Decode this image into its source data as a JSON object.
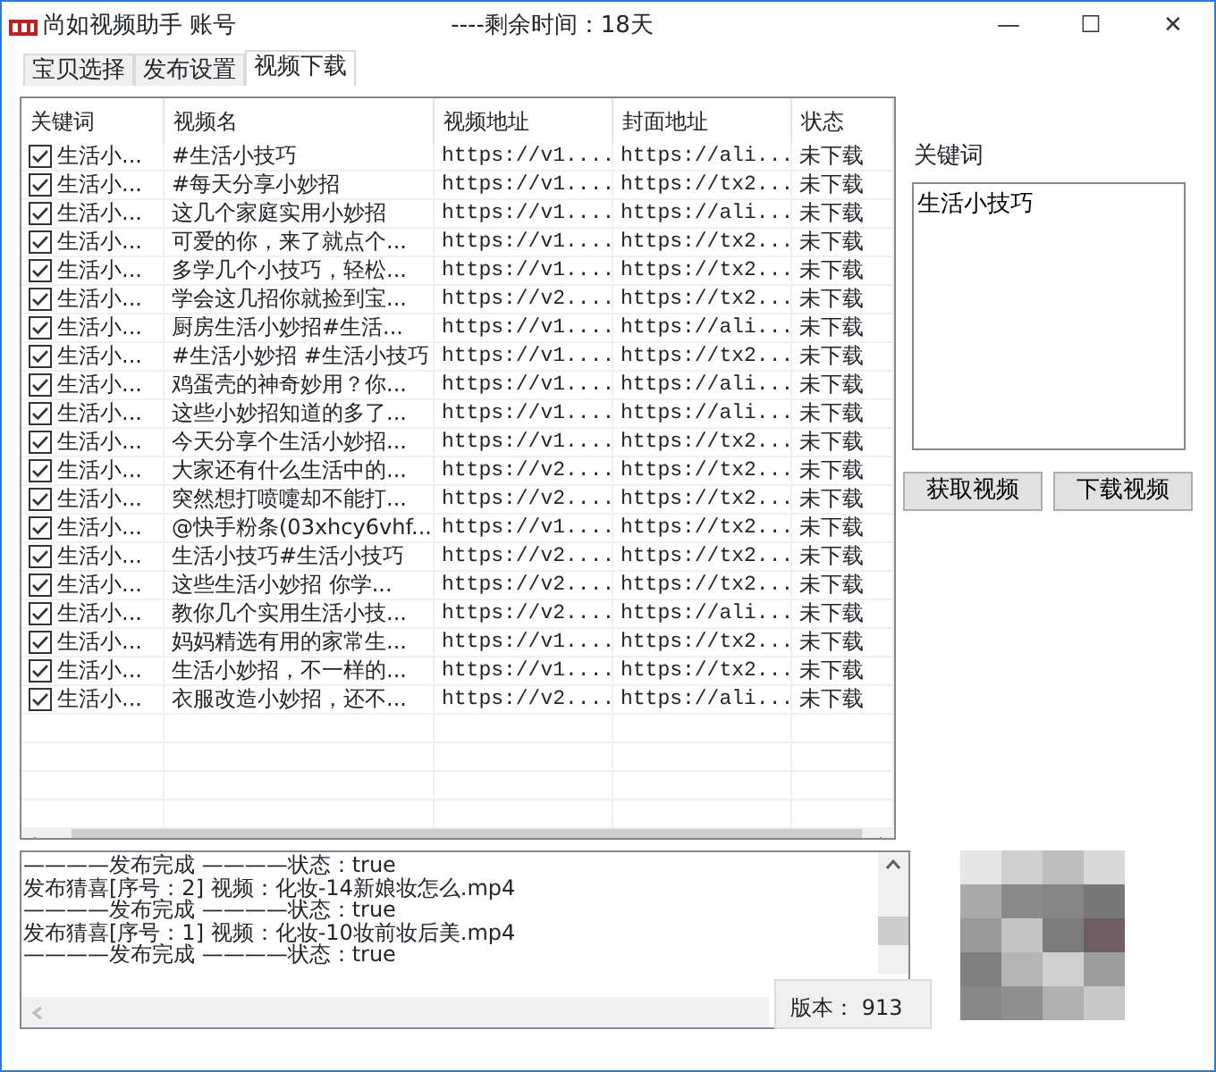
{
  "window": {
    "app_title": "尚如视频助手 账号",
    "remaining": "----剩余时间：18天",
    "controls": [
      "—",
      "☐",
      "✕"
    ]
  },
  "tabs": [
    {
      "label": "宝贝选择",
      "selected": false
    },
    {
      "label": "发布设置",
      "selected": false
    },
    {
      "label": "视频下载",
      "selected": true
    }
  ],
  "table": {
    "columns": [
      "关键词",
      "视频名",
      "视频地址",
      "封面地址",
      "状态"
    ],
    "rows": [
      {
        "checked": true,
        "keyword": "生活小...",
        "name": "#生活小技巧",
        "video_url": "https://v1....",
        "cover_url": "https://ali...",
        "status": "未下载"
      },
      {
        "checked": true,
        "keyword": "生活小...",
        "name": "#每天分享小妙招",
        "video_url": "https://v1....",
        "cover_url": "https://tx2...",
        "status": "未下载"
      },
      {
        "checked": true,
        "keyword": "生活小...",
        "name": "这几个家庭实用小妙招",
        "video_url": "https://v1....",
        "cover_url": "https://ali...",
        "status": "未下载"
      },
      {
        "checked": true,
        "keyword": "生活小...",
        "name": "可爱的你，来了就点个...",
        "video_url": "https://v1....",
        "cover_url": "https://tx2...",
        "status": "未下载"
      },
      {
        "checked": true,
        "keyword": "生活小...",
        "name": "多学几个小技巧，轻松...",
        "video_url": "https://v1....",
        "cover_url": "https://tx2...",
        "status": "未下载"
      },
      {
        "checked": true,
        "keyword": "生活小...",
        "name": "学会这几招你就捡到宝...",
        "video_url": "https://v2....",
        "cover_url": "https://tx2...",
        "status": "未下载"
      },
      {
        "checked": true,
        "keyword": "生活小...",
        "name": "厨房生活小妙招#生活...",
        "video_url": "https://v1....",
        "cover_url": "https://ali...",
        "status": "未下载"
      },
      {
        "checked": true,
        "keyword": "生活小...",
        "name": "#生活小妙招 #生活小技巧",
        "video_url": "https://v1....",
        "cover_url": "https://tx2...",
        "status": "未下载"
      },
      {
        "checked": true,
        "keyword": "生活小...",
        "name": "鸡蛋壳的神奇妙用？你...",
        "video_url": "https://v1....",
        "cover_url": "https://ali...",
        "status": "未下载"
      },
      {
        "checked": true,
        "keyword": "生活小...",
        "name": "这些小妙招知道的多了...",
        "video_url": "https://v1....",
        "cover_url": "https://ali...",
        "status": "未下载"
      },
      {
        "checked": true,
        "keyword": "生活小...",
        "name": "今天分享个生活小妙招...",
        "video_url": "https://v1....",
        "cover_url": "https://tx2...",
        "status": "未下载"
      },
      {
        "checked": true,
        "keyword": "生活小...",
        "name": "大家还有什么生活中的...",
        "video_url": "https://v2....",
        "cover_url": "https://tx2...",
        "status": "未下载"
      },
      {
        "checked": true,
        "keyword": "生活小...",
        "name": "突然想打喷嚏却不能打...",
        "video_url": "https://v2....",
        "cover_url": "https://tx2...",
        "status": "未下载"
      },
      {
        "checked": true,
        "keyword": "生活小...",
        "name": "@快手粉条(03xhcy6vhf...",
        "video_url": "https://v1....",
        "cover_url": "https://tx2...",
        "status": "未下载"
      },
      {
        "checked": true,
        "keyword": "生活小...",
        "name": "生活小技巧#生活小技巧",
        "video_url": "https://v2....",
        "cover_url": "https://tx2...",
        "status": "未下载"
      },
      {
        "checked": true,
        "keyword": "生活小...",
        "name": "这些生活小妙招 你学...",
        "video_url": "https://v2....",
        "cover_url": "https://tx2...",
        "status": "未下载"
      },
      {
        "checked": true,
        "keyword": "生活小...",
        "name": "教你几个实用生活小技...",
        "video_url": "https://v2....",
        "cover_url": "https://ali...",
        "status": "未下载"
      },
      {
        "checked": true,
        "keyword": "生活小...",
        "name": "妈妈精选有用的家常生...",
        "video_url": "https://v1....",
        "cover_url": "https://tx2...",
        "status": "未下载"
      },
      {
        "checked": true,
        "keyword": "生活小...",
        "name": "生活小妙招，不一样的...",
        "video_url": "https://v1....",
        "cover_url": "https://tx2...",
        "status": "未下载"
      },
      {
        "checked": true,
        "keyword": "生活小...",
        "name": "衣服改造小妙招，还不...",
        "video_url": "https://v2....",
        "cover_url": "https://ali...",
        "status": "未下载"
      }
    ]
  },
  "keyword_panel": {
    "label": "关键词",
    "value": "生活小技巧",
    "buttons": [
      "获取视频",
      "下载视频"
    ]
  },
  "log": [
    "————发布完成 ————状态：true",
    "发布猜喜[序号：2] 视频：化妆-14新娘妆怎么.mp4",
    "————发布完成 ————状态：true",
    "发布猜喜[序号：1] 视频：化妆-10妆前妆后美.mp4",
    "————发布完成 ————状态：true"
  ],
  "version": "版本： 913"
}
